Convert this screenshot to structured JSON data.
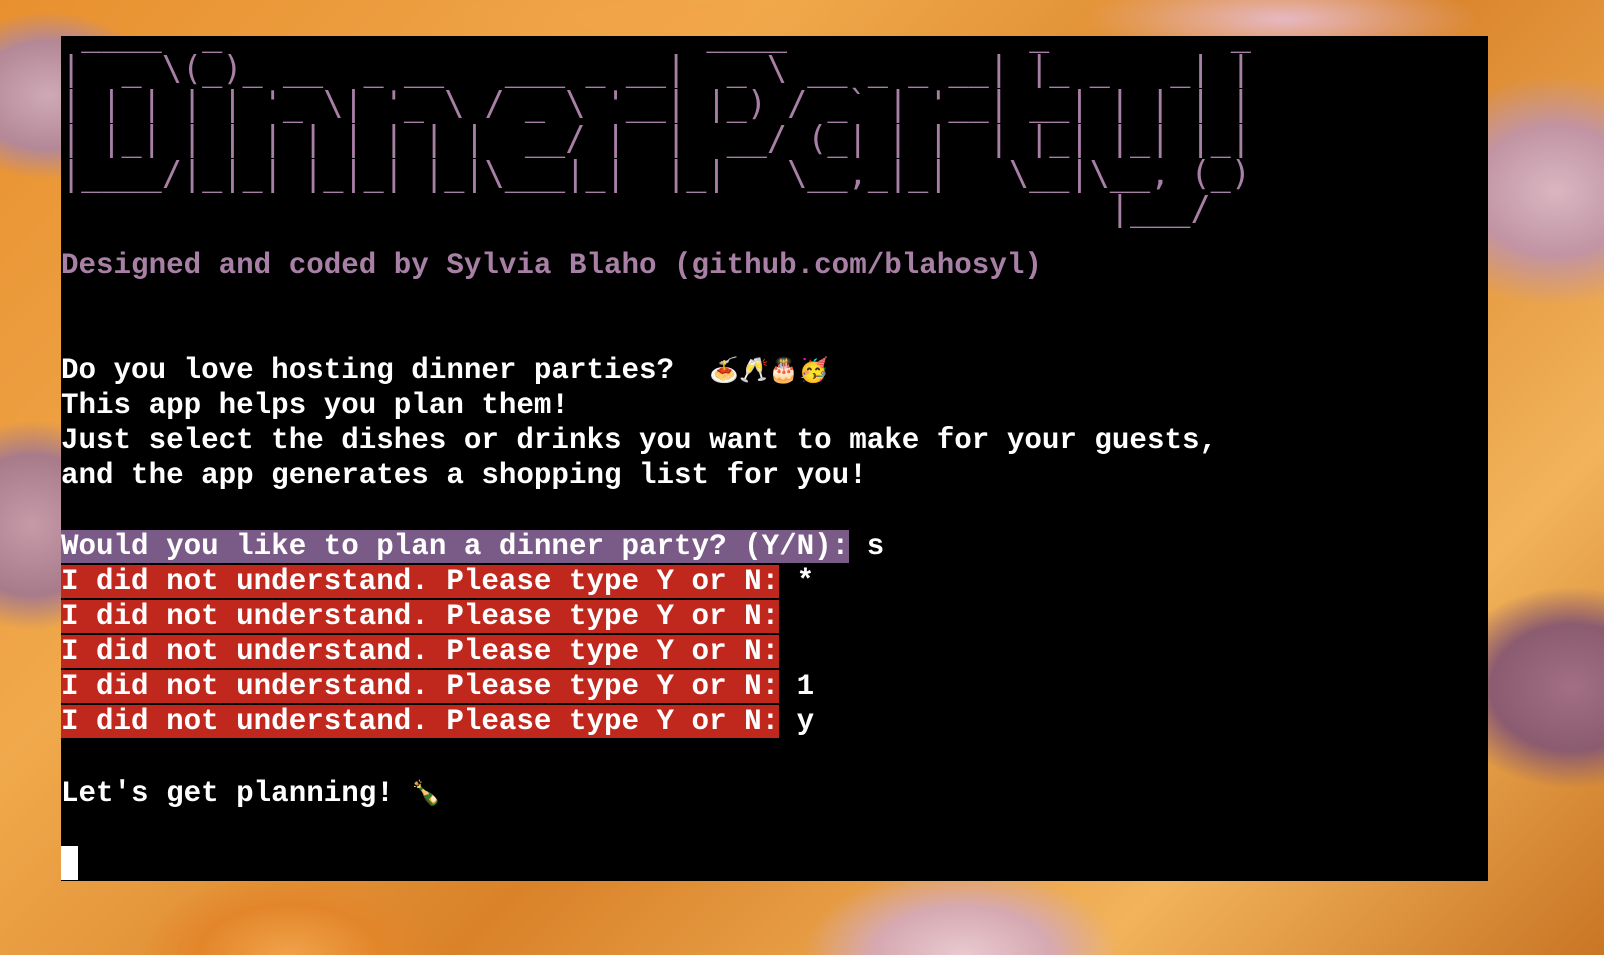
{
  "terminal": {
    "title_ascii": " ____  _                        ____            _         _ \n|  _ \\(_)_ __  _ __   ___ _ __|  _ \\ __ _ _ __| |_ _   _| |\n| | | | | '_ \\| '_ \\ / _ \\ '__| |_) / _` | '__| __| | | | |\n| |_| | | | | | | | |  __/ |  |  __/ (_| | |  | |_| |_| |_|\n|____/|_|_| |_|_| |_|\\___|_|  |_|   \\__,_|_|   \\__|\\__, (_)\n                                                    |___/   ",
    "credit": "Designed and coded by Sylvia Blaho (github.com/blahosyl)",
    "intro_lines": [
      "Do you love hosting dinner parties?  ",
      "This app helps you plan them!",
      "Just select the dishes or drinks you want to make for your guests,",
      "and the app generates a shopping list for you!"
    ],
    "intro_emojis": "🍝🥂🎂🥳",
    "prompt": {
      "text": "Would you like to plan a dinner party? (Y/N):",
      "answer": " s"
    },
    "errors": [
      {
        "text": "I did not understand. Please type Y or N:",
        "answer": " *"
      },
      {
        "text": "I did not understand. Please type Y or N:",
        "answer": ""
      },
      {
        "text": "I did not understand. Please type Y or N:",
        "answer": ""
      },
      {
        "text": "I did not understand. Please type Y or N:",
        "answer": " 1"
      },
      {
        "text": "I did not understand. Please type Y or N:",
        "answer": " y"
      }
    ],
    "closing": "Let's get planning! ",
    "closing_emoji": "🍾",
    "colors": {
      "ascii_title": "#a880a6",
      "prompt_highlight": "#7a5a87",
      "error_highlight": "#c0281e",
      "background": "#000000",
      "text": "#ffffff"
    }
  }
}
